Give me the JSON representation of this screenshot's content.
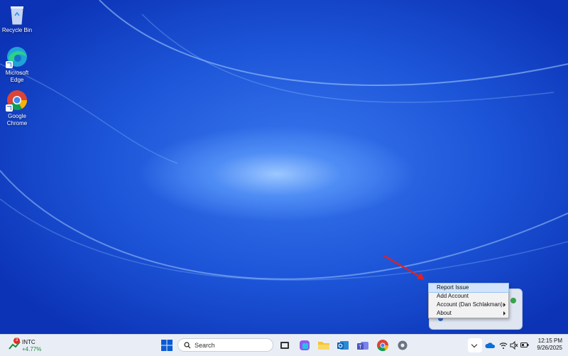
{
  "desktop": {
    "icons": [
      {
        "label": "Recycle Bin"
      },
      {
        "label": "Microsoft Edge"
      },
      {
        "label": "Google Chrome"
      }
    ]
  },
  "context_menu": {
    "items": [
      {
        "label": "Report Issue",
        "highlighted": true,
        "submenu": false
      },
      {
        "label": "Add Account",
        "submenu": false
      },
      {
        "label": "Account (Dan Schlakman)",
        "submenu": true
      },
      {
        "label": "About",
        "submenu": true
      }
    ]
  },
  "taskbar": {
    "stock": {
      "ticker": "INTC",
      "change": "+4.77%",
      "badge": "3"
    },
    "search": {
      "placeholder": "Search"
    },
    "clock": {
      "time": "12:15 PM",
      "date": "9/26/2025"
    }
  },
  "colors": {
    "accent": "#0a5bd3",
    "menu_highlight": "#d2e4fb",
    "arrow": "#e0211f",
    "stock_up": "#1c8a3a"
  }
}
